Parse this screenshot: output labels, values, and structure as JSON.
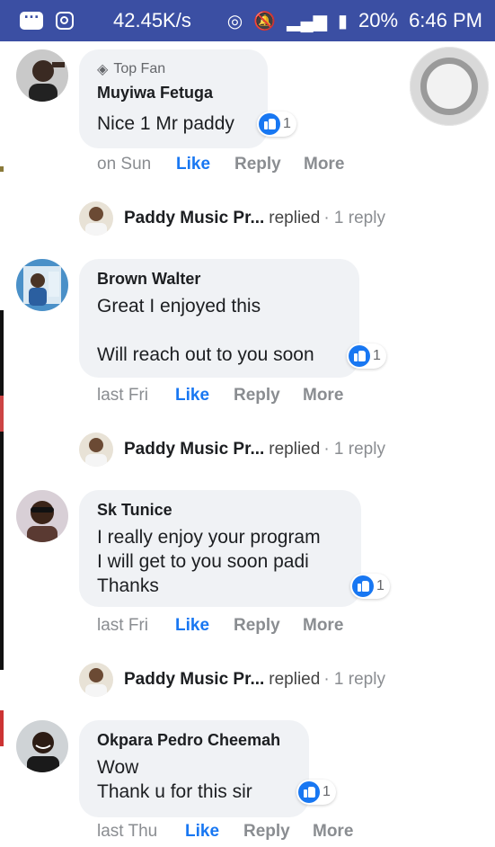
{
  "status_bar": {
    "speed": "42.45K/s",
    "battery": "20%",
    "time": "6:46 PM",
    "icons": [
      "message-icon",
      "instagram-icon",
      "hotspot-icon",
      "mute-icon",
      "signal-icon",
      "battery-icon"
    ]
  },
  "comments": [
    {
      "badge": "Top Fan",
      "name": "Muyiwa Fetuga",
      "text": "Nice 1 Mr paddy",
      "reactions": "1",
      "time": "on Sun",
      "like": "Like",
      "reply": "Reply",
      "more": "More",
      "replied": {
        "name": "Paddy Music Pr...",
        "action": "replied",
        "count": "· 1 reply"
      }
    },
    {
      "name": "Brown Walter",
      "text": "Great I enjoyed this\n\nWill reach out to you soon",
      "reactions": "1",
      "time": "last Fri",
      "like": "Like",
      "reply": "Reply",
      "more": "More",
      "replied": {
        "name": "Paddy Music Pr...",
        "action": "replied",
        "count": "· 1 reply"
      }
    },
    {
      "name": "Sk Tunice",
      "text": "I really enjoy your program\nI will get to you soon padi\nThanks",
      "reactions": "1",
      "time": "last Fri",
      "like": "Like",
      "reply": "Reply",
      "more": "More",
      "replied": {
        "name": "Paddy Music Pr...",
        "action": "replied",
        "count": "· 1 reply"
      }
    },
    {
      "name": "Okpara Pedro Cheemah",
      "text": "Wow\nThank u for this sir",
      "reactions": "1",
      "time": "last Thu",
      "like": "Like",
      "reply": "Reply",
      "more": "More"
    }
  ],
  "colors": {
    "status_bar": "#3b4fa3",
    "like_blue": "#1877f2",
    "bubble": "#f0f2f5"
  }
}
